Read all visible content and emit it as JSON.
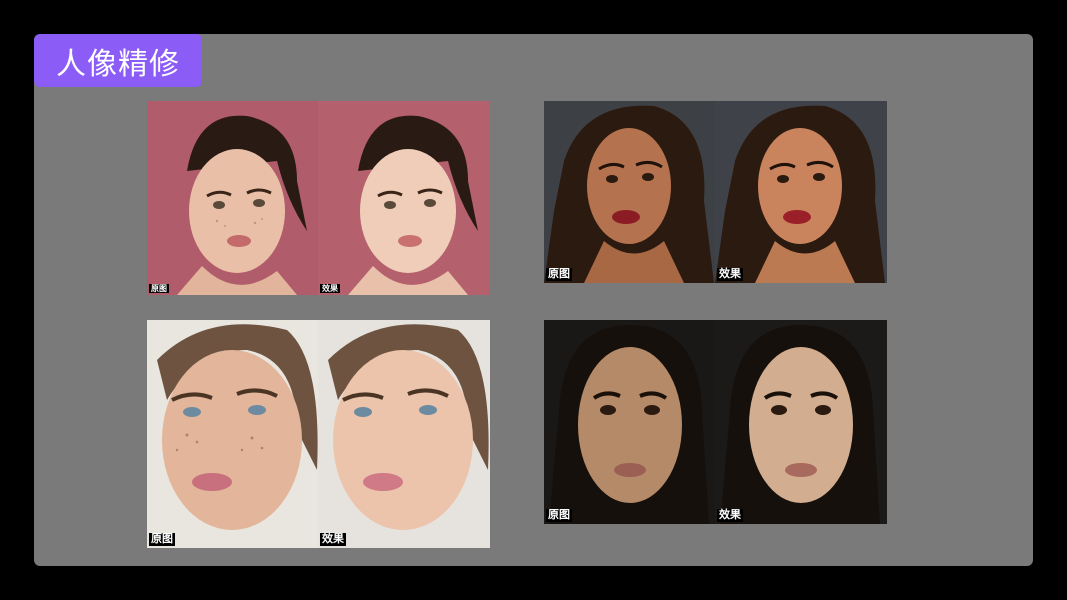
{
  "title": "人像精修",
  "colors": {
    "accent": "#8b5cf6",
    "panel": "#7a7a7a",
    "outer": "#000000"
  },
  "labels": {
    "before": "原图",
    "after": "效果"
  },
  "examples": [
    {
      "id": "pink-bg",
      "before": "原图",
      "after": "效果",
      "bg": "#b15c6a"
    },
    {
      "id": "dark-gray-bg",
      "before": "原图",
      "after": "效果",
      "bg": "#3d4146"
    },
    {
      "id": "light-bg",
      "before": "原图",
      "after": "效果",
      "bg": "#e9e6e0"
    },
    {
      "id": "black-bg",
      "before": "原图",
      "after": "效果",
      "bg": "#1a1817"
    }
  ]
}
